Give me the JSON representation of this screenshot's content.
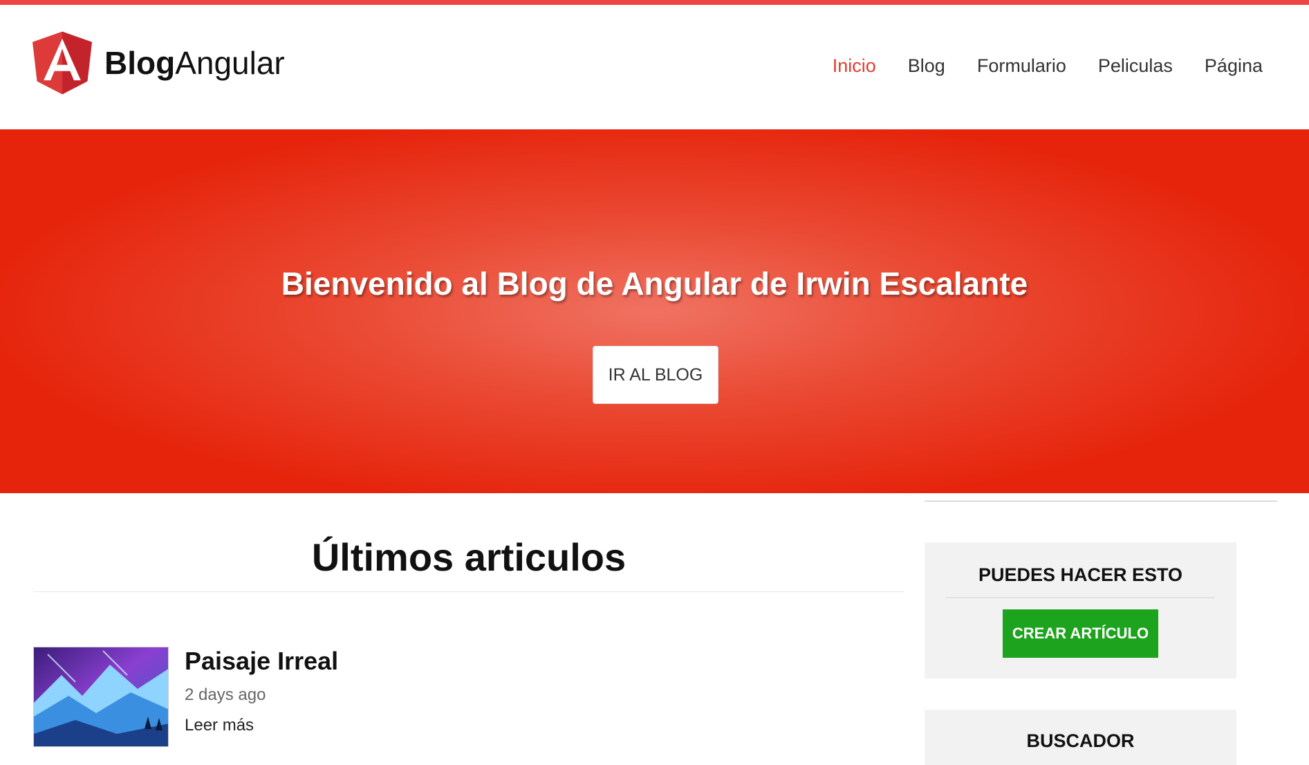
{
  "brand": {
    "name_bold": "Blog",
    "name_light": "Angular",
    "logo_icon": "angular-shield-icon",
    "accent_color": "#e53b2e"
  },
  "nav": {
    "items": [
      {
        "label": "Inicio",
        "active": true
      },
      {
        "label": "Blog",
        "active": false
      },
      {
        "label": "Formulario",
        "active": false
      },
      {
        "label": "Peliculas",
        "active": false
      },
      {
        "label": "Página",
        "active": false
      }
    ]
  },
  "hero": {
    "title": "Bienvenido al Blog de Angular de Irwin Escalante",
    "button_label": "IR AL BLOG",
    "background_color": "#e6230b"
  },
  "main": {
    "section_title": "Últimos articulos",
    "articles": [
      {
        "title": "Paisaje Irreal",
        "date": "2 days ago",
        "link_label": "Leer más",
        "image_icon": "landscape-thumbnail"
      }
    ]
  },
  "sidebar": {
    "widgets": [
      {
        "title": "PUEDES HACER ESTO",
        "button_label": "CREAR ARTÍCULO",
        "button_color": "#1ea31e"
      },
      {
        "title": "BUSCADOR"
      }
    ]
  }
}
